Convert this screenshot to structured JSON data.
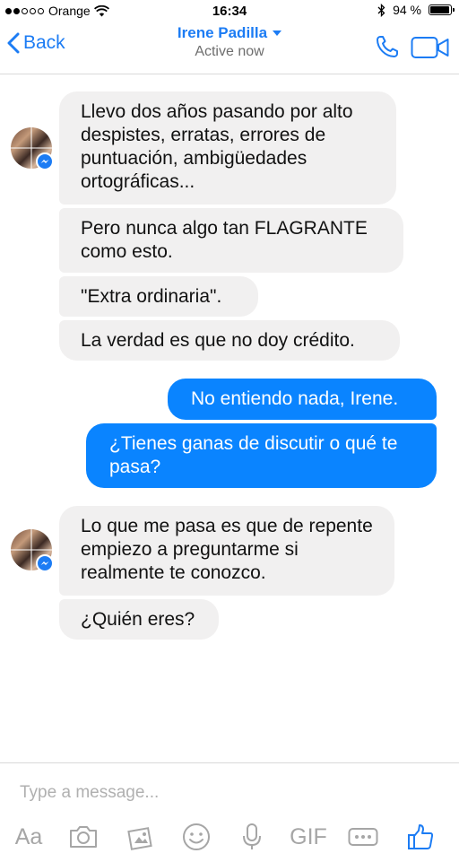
{
  "status_bar": {
    "carrier": "Orange",
    "time": "16:34",
    "battery": "94 %",
    "battery_level": 0.94,
    "signal_bars_filled": 2,
    "signal_bars_total": 5
  },
  "nav": {
    "back_label": "Back",
    "contact_name": "Irene Padilla",
    "status": "Active now"
  },
  "messages": [
    {
      "from": "contact",
      "text": "Llevo dos años pasando por alto despistes, erratas, errores de puntuación, ambigüedades ortográficas..."
    },
    {
      "from": "contact",
      "text": "Pero nunca algo tan FLAGRANTE como esto."
    },
    {
      "from": "contact",
      "text": "\"Extra ordinaria\"."
    },
    {
      "from": "contact",
      "text": "La verdad es que no doy crédito."
    },
    {
      "from": "me",
      "text": "No entiendo nada, Irene."
    },
    {
      "from": "me",
      "text": "¿Tienes ganas de discutir o qué te pasa?"
    },
    {
      "from": "contact",
      "text": "Lo que me pasa es que de repente empiezo a preguntarme si realmente te conozco."
    },
    {
      "from": "contact",
      "text": "¿Quién eres?"
    }
  ],
  "composer": {
    "placeholder": "Type a message...",
    "toolbar": {
      "text_label": "Aa",
      "gif_label": "GIF"
    }
  },
  "colors": {
    "accent": "#1c7cf4",
    "sent_bubble": "#0a84ff",
    "received_bubble": "#f1f0f0",
    "toolbar_icon": "#a6a6a6"
  }
}
